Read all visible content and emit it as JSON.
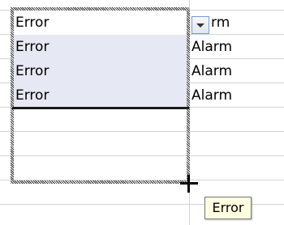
{
  "grid": {
    "column_a": [
      "Error",
      "Error",
      "Error",
      "Error"
    ],
    "column_b": [
      "rm",
      "Alarm",
      "Alarm",
      "Alarm"
    ]
  },
  "tooltip": {
    "text": "Error"
  },
  "icons": {
    "dropdown": "chevron-down-icon",
    "cursor": "fill-handle-crosshair-icon"
  },
  "colors": {
    "selection_fill": "#e6e8f4",
    "tooltip_bg": "#ffffe1",
    "gridline": "#d4d4d4"
  }
}
